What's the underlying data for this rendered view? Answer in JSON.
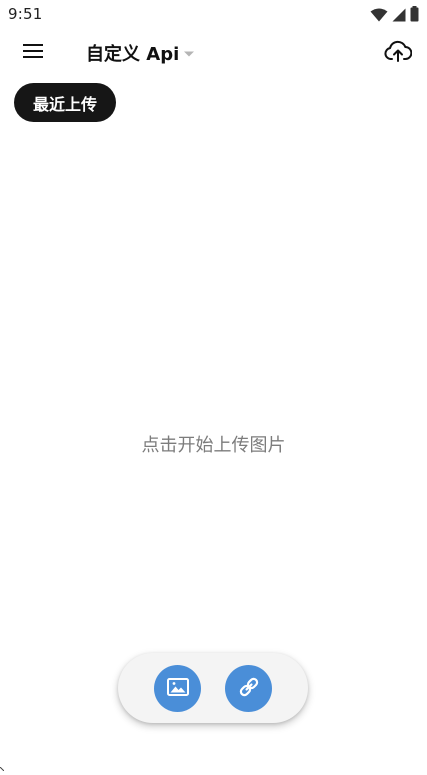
{
  "status_bar": {
    "time": "9:51",
    "icons": [
      "wifi-icon",
      "signal-icon",
      "battery-icon"
    ]
  },
  "app_bar": {
    "title": "自定义 Api",
    "icons": {
      "menu": "menu-icon",
      "dropdown": "arrow-drop-down-icon",
      "upload": "cloud-upload-icon"
    }
  },
  "chip": {
    "label": "最近上传"
  },
  "empty_state": {
    "hint": "点击开始上传图片"
  },
  "fab_bar": {
    "buttons": [
      {
        "icon": "image-icon"
      },
      {
        "icon": "link-icon"
      }
    ]
  },
  "colors": {
    "accent": "#4a8ed8",
    "chip_bg": "#161616",
    "hint_text": "#7c7c7c",
    "fab_bar_bg": "#f4f4f4"
  }
}
